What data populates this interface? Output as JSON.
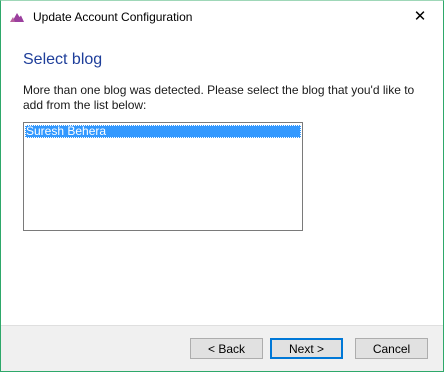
{
  "window": {
    "title": "Update Account Configuration",
    "close_glyph": "✕",
    "app_icon": "cloud-icon",
    "accent_color": "#2ea86a"
  },
  "content": {
    "heading": "Select blog",
    "description": "More than one blog was detected. Please select the blog that you'd like to add from the list below:",
    "list_items": [
      {
        "label": "Suresh Behera",
        "selected": true
      }
    ],
    "heading_color": "#1e3e9a",
    "selection_color": "#3399ff"
  },
  "footer": {
    "back_label": "< Back",
    "next_label": "Next >",
    "cancel_label": "Cancel"
  }
}
